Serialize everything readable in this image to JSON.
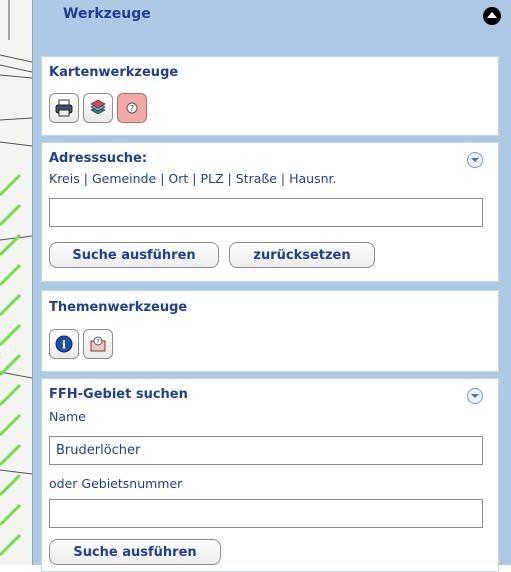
{
  "panel": {
    "title": "Werkzeuge"
  },
  "kartenwerkzeuge": {
    "title": "Kartenwerkzeuge",
    "tools": [
      {
        "icon": "print-icon"
      },
      {
        "icon": "layers-icon"
      },
      {
        "icon": "help-icon",
        "active": true
      }
    ]
  },
  "adresssuche": {
    "title": "Adresssuche:",
    "links": [
      "Kreis",
      "Gemeinde",
      "Ort",
      "PLZ",
      "Straße",
      "Hausnr."
    ],
    "input_value": "",
    "search_label": "Suche ausführen",
    "reset_label": "zurücksetzen"
  },
  "themenwerkzeuge": {
    "title": "Themenwerkzeuge",
    "tools": [
      {
        "icon": "info-icon"
      },
      {
        "icon": "help-icon"
      }
    ]
  },
  "ffh": {
    "title": "FFH-Gebiet suchen",
    "name_label": "Name",
    "name_value": "Bruderlöcher",
    "number_label": "oder Gebietsnummer",
    "number_value": "",
    "search_label": "Suche ausführen"
  },
  "colors": {
    "panel_bg": "#aec9e6",
    "title_color": "#1f3f8f",
    "active_tool": "#f4a7a7"
  }
}
